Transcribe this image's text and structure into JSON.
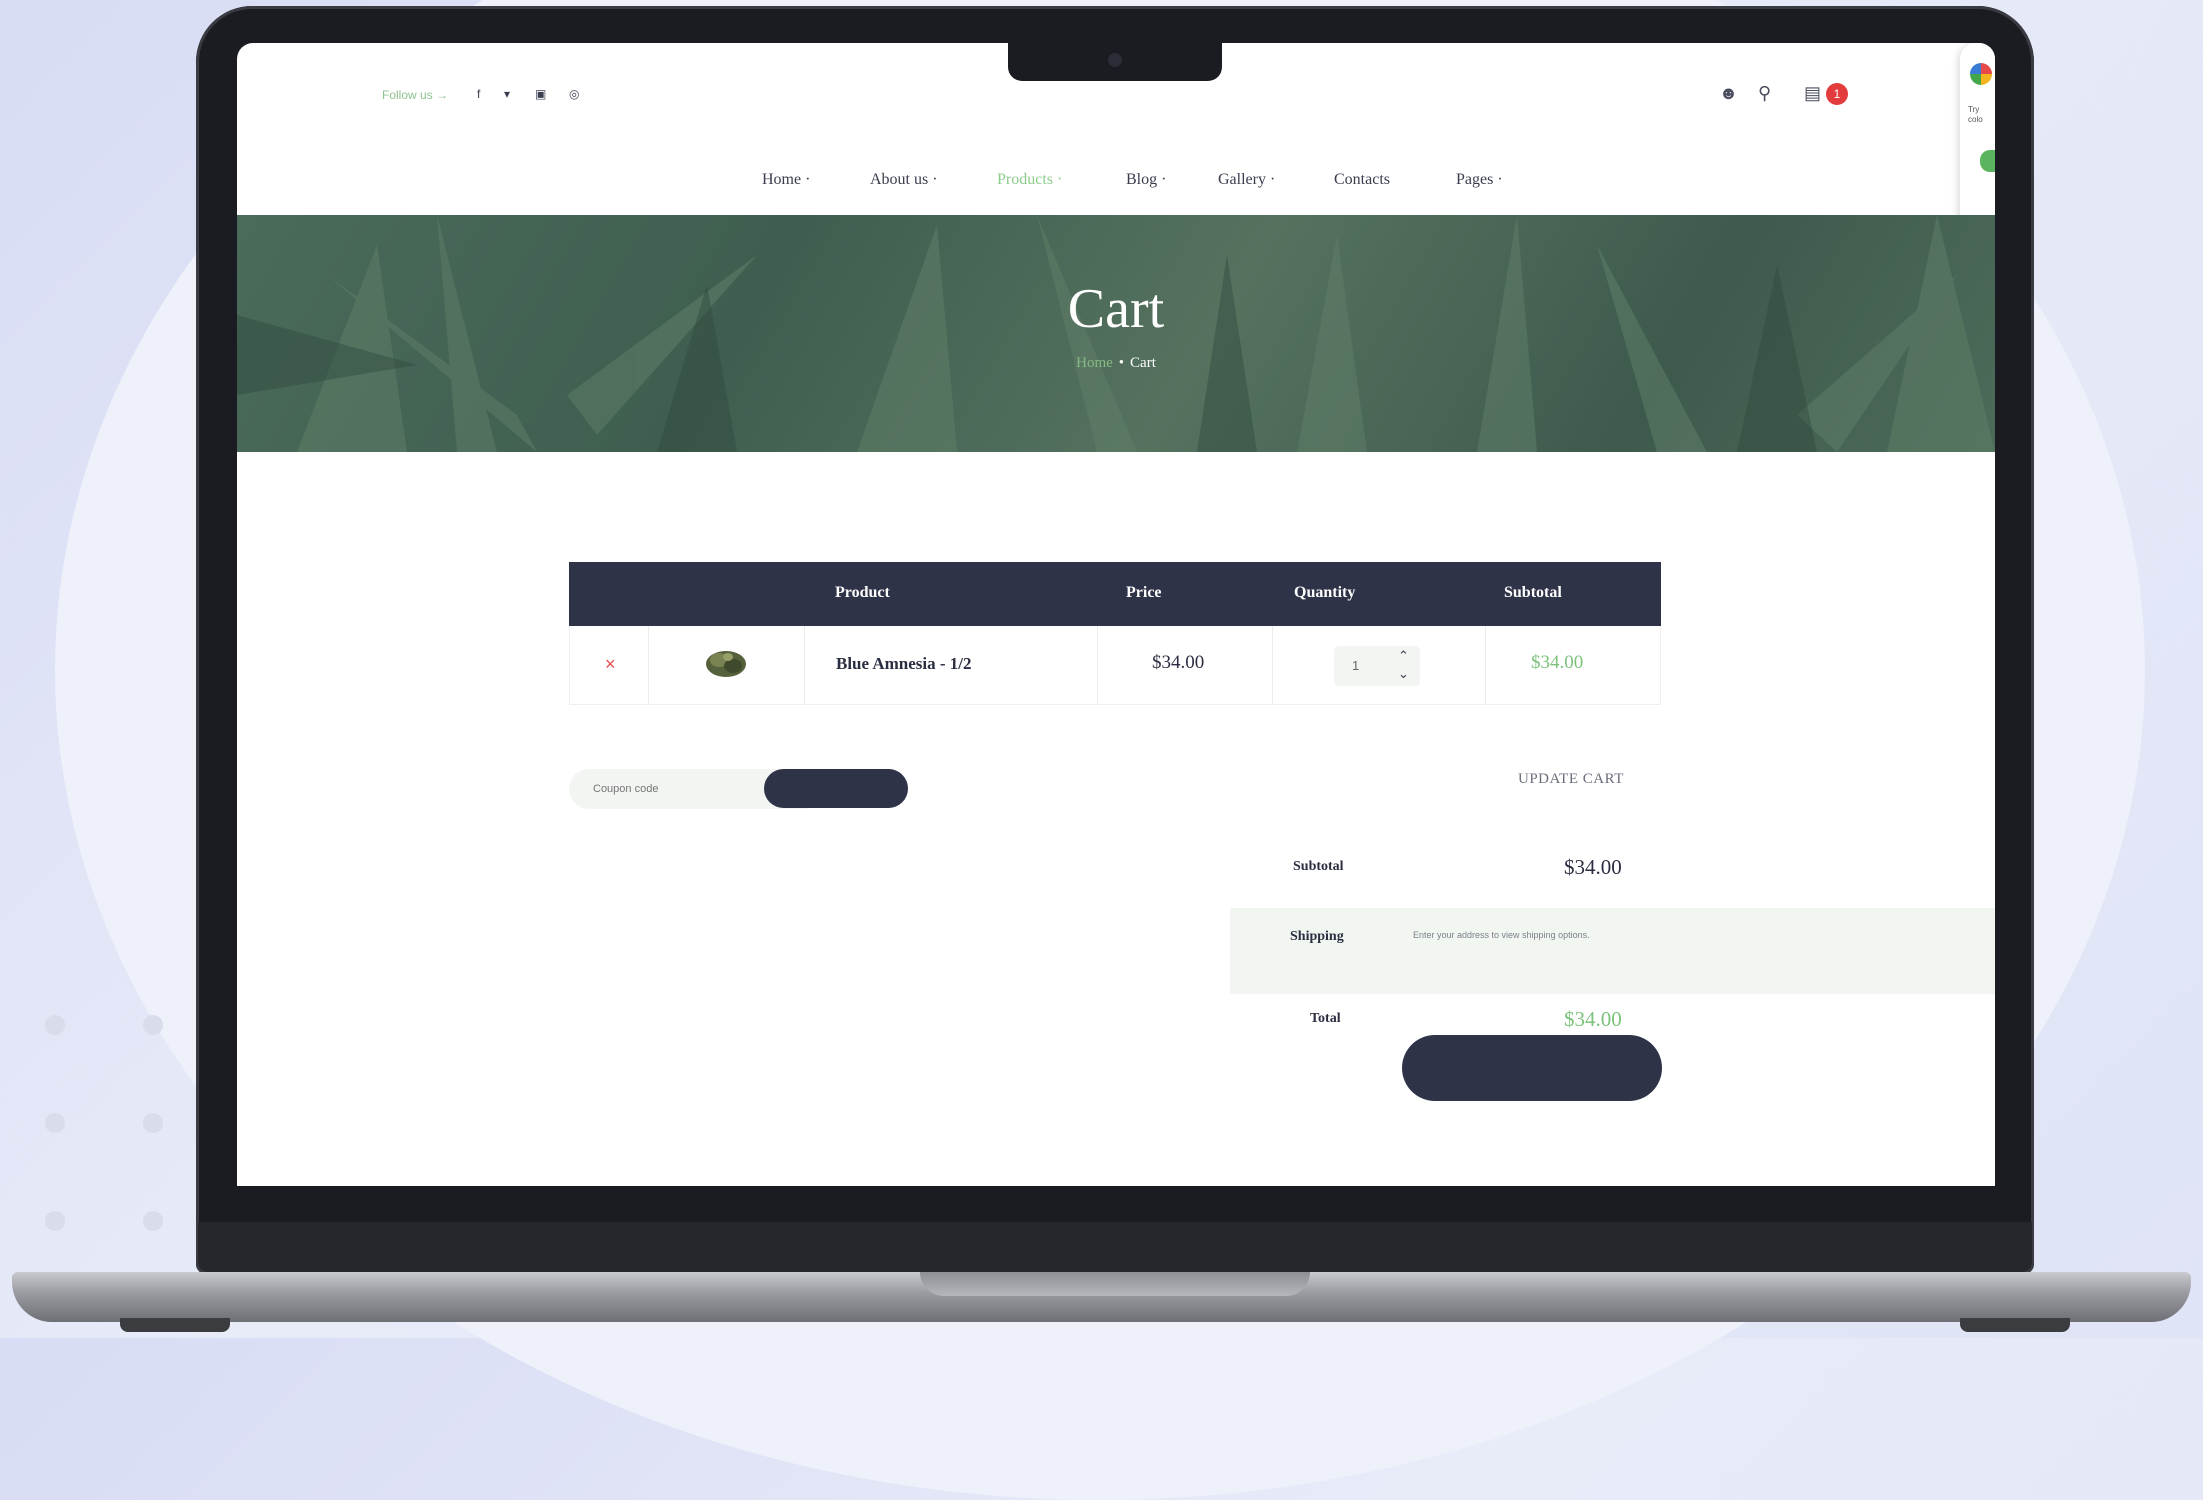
{
  "header": {
    "follow_label": "Follow us →",
    "social_icons": [
      "facebook-icon",
      "twitter-icon",
      "instagram-icon",
      "pinterest-icon"
    ],
    "cart_count": "1"
  },
  "nav": {
    "items": [
      {
        "label": "Home ·",
        "active": false
      },
      {
        "label": "About us ·",
        "active": false
      },
      {
        "label": "Products ·",
        "active": true
      },
      {
        "label": "Blog ·",
        "active": false
      },
      {
        "label": "Gallery ·",
        "active": false
      },
      {
        "label": "Contacts",
        "active": false
      },
      {
        "label": "Pages ·",
        "active": false
      }
    ]
  },
  "hero": {
    "title": "Cart",
    "breadcrumb_home": "Home",
    "breadcrumb_separator": "•",
    "breadcrumb_current": "Cart"
  },
  "cart": {
    "columns": [
      "Product",
      "Price",
      "Quantity",
      "Subtotal"
    ],
    "rows": [
      {
        "remove": "×",
        "name": "Blue Amnesia - 1/2",
        "price": "$34.00",
        "quantity": "1",
        "subtotal": "$34.00"
      }
    ],
    "coupon_placeholder": "Coupon code",
    "update_label": "UPDATE CART"
  },
  "totals": {
    "subtotal_label": "Subtotal",
    "subtotal_value": "$34.00",
    "shipping_label": "Shipping",
    "shipping_note": "Enter your address to view shipping options.",
    "total_label": "Total",
    "total_value": "$34.00"
  },
  "side_panel": {
    "text": "Try\ncolo"
  },
  "colors": {
    "accent_green": "#7cc27c",
    "dark_navy": "#2e3348",
    "badge_red": "#e23c3c"
  }
}
